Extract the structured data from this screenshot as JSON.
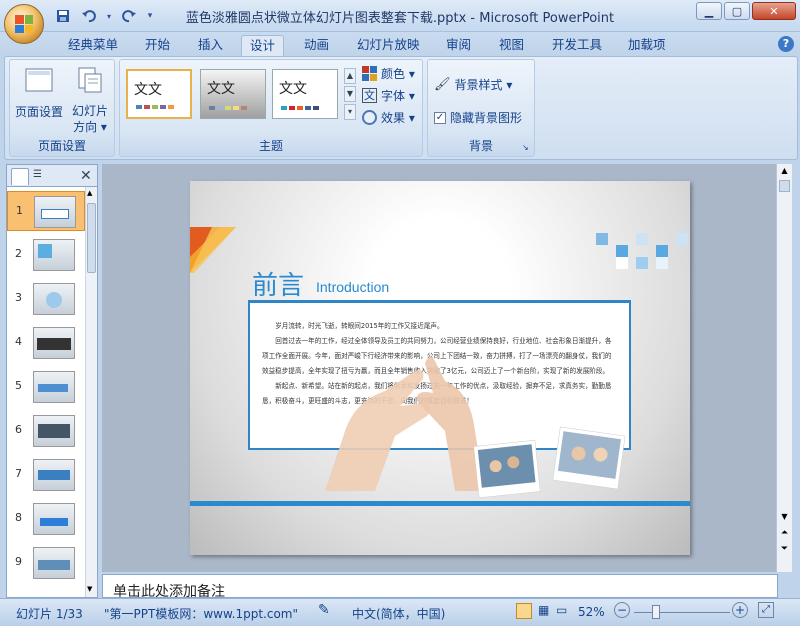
{
  "window": {
    "title": "蓝色淡雅圆点状微立体幻灯片图表整套下载.pptx - Microsoft PowerPoint"
  },
  "qat": {
    "save_icon": "save-icon",
    "undo_icon": "undo-icon",
    "redo_icon": "redo-icon"
  },
  "tabs": [
    "经典菜单",
    "开始",
    "插入",
    "设计",
    "动画",
    "幻灯片放映",
    "审阅",
    "视图",
    "开发工具",
    "加载项"
  ],
  "active_tab": "设计",
  "ribbon": {
    "page_setup": {
      "label": "页面设置",
      "page_setup_btn": "页面设置",
      "orientation_btn_line1": "幻灯片",
      "orientation_btn_line2": "方向 ▾"
    },
    "theme": {
      "label": "主题",
      "thumbs": [
        "文文",
        "文文",
        "文文"
      ],
      "colors": "颜色 ▾",
      "fonts": "字体 ▾",
      "effects": "效果 ▾"
    },
    "background": {
      "label": "背景",
      "styles": "背景样式 ▾",
      "hide_graphics": "隐藏背景图形",
      "hide_checked": true
    }
  },
  "slides": {
    "numbers": [
      "1",
      "2",
      "3",
      "4",
      "5",
      "6",
      "7",
      "8",
      "9"
    ],
    "selected": 1
  },
  "slide_content": {
    "title_cn": "前言",
    "title_en": "Introduction",
    "body": [
      "岁月流转，时光飞逝，转眼间2015年的工作又接近尾声。",
      "回首过去一年的工作，经过全体领导及员工的共同努力，公司经营业绩保持良好，行业地位、社会形象日渐提升，各项工作全面开展。今年，面对严峻下行经济带来的影响，公司上下团结一致，奋力拼搏，打了一场漂亮的翻身仗，我们的效益稳步提高，全年实现了扭亏为赢，而且全年销售收入突破了3亿元，公司迈上了一个新台阶，实现了新的发展阶段。",
      "新起点、新希望。站在新的起点，我们将继承和发扬过去一年工作的优点，汲取经验，摒弃不足，求真务实，勤勤恳恳，积极奋斗，更旺盛的斗志，更充沛的干劲，向我们的既定目标前进！"
    ]
  },
  "notes": {
    "placeholder": "单击此处添加备注"
  },
  "status": {
    "slide_info": "幻灯片 1/33",
    "theme_name": "\"第一PPT模板网：www.1ppt.com\"",
    "language": "中文(简体，中国)",
    "zoom": "52%",
    "zoom_level": 52
  }
}
